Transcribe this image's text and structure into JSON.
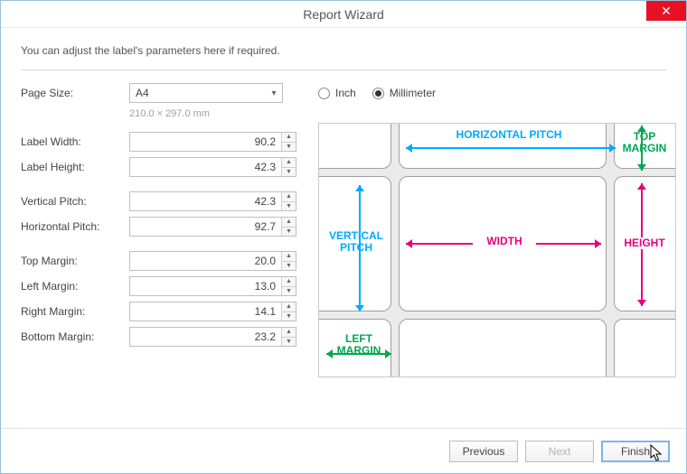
{
  "window": {
    "title": "Report Wizard"
  },
  "intro": "You can adjust the label's parameters here if required.",
  "pageSize": {
    "label": "Page Size:",
    "value": "A4",
    "sub": "210.0 × 297.0 mm"
  },
  "units": {
    "inch": {
      "label": "Inch",
      "checked": false
    },
    "mm": {
      "label": "Millimeter",
      "checked": true
    }
  },
  "fields": {
    "labelWidth": {
      "label": "Label Width:",
      "value": "90.2"
    },
    "labelHeight": {
      "label": "Label Height:",
      "value": "42.3"
    },
    "verticalPitch": {
      "label": "Vertical Pitch:",
      "value": "42.3"
    },
    "horizontalPitch": {
      "label": "Horizontal Pitch:",
      "value": "92.7"
    },
    "topMargin": {
      "label": "Top Margin:",
      "value": "20.0"
    },
    "leftMargin": {
      "label": "Left Margin:",
      "value": "13.0"
    },
    "rightMargin": {
      "label": "Right Margin:",
      "value": "14.1"
    },
    "bottomMargin": {
      "label": "Bottom Margin:",
      "value": "23.2"
    }
  },
  "preview": {
    "hpitch": "HORIZONTAL PITCH",
    "vpitch": "VERTICAL PITCH",
    "width": "WIDTH",
    "height": "HEIGHT",
    "topMargin": "TOP MARGIN",
    "leftMargin": "LEFT MARGIN"
  },
  "buttons": {
    "previous": "Previous",
    "next": "Next",
    "finish": "Finish"
  }
}
